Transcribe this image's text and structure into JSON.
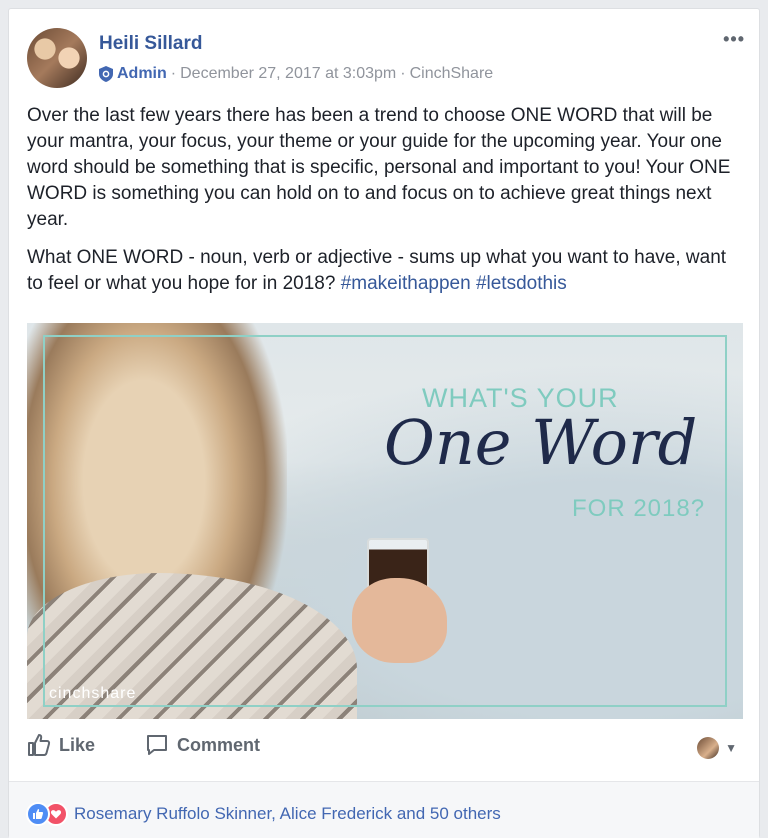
{
  "post": {
    "author": "Heili Sillard",
    "role": "Admin",
    "separator1": "·",
    "date": "December 27, 2017 at 3:03pm",
    "separator2": "·",
    "source": "CinchShare",
    "more_label": "•••",
    "paragraph1": "Over the last few years there has been a trend to choose ONE WORD that will be your mantra, your focus, your theme or your guide for the upcoming year. Your one word should be something that is specific, personal and important to you! Your ONE WORD is something you can hold on to and focus on to achieve great things next year.",
    "paragraph2": "What ONE WORD - noun, verb or adjective - sums up what you want to have, want to feel or what you hope for in 2018?",
    "hashtags": [
      "#makeithappen",
      "#letsdothis"
    ]
  },
  "image": {
    "headline_top": "WHAT'S YOUR",
    "headline_main": "One Word",
    "headline_bottom": "FOR 2018?",
    "brand": "cinchshare"
  },
  "actions": {
    "like": "Like",
    "comment": "Comment"
  },
  "footer": {
    "reactors": "Rosemary Ruffolo Skinner, Alice Frederick and 50 others"
  },
  "colors": {
    "link": "#365899",
    "accent_teal": "#7fcbbf",
    "like_blue": "#4f8df5",
    "love_red": "#f25268"
  }
}
